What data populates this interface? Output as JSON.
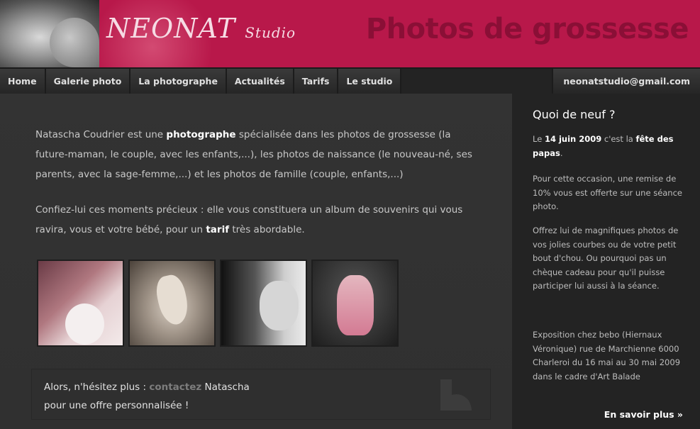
{
  "header": {
    "logo_main": "NEONAT",
    "logo_sub": "Studio",
    "tagline": "Photos de grossesse"
  },
  "nav": {
    "items": [
      "Home",
      "Galerie photo",
      "La photographe",
      "Actualités",
      "Tarifs",
      "Le studio"
    ],
    "email": "neonatstudio@gmail.com"
  },
  "intro": {
    "p1_a": "Natascha Coudrier est une ",
    "p1_b": "photographe",
    "p1_c": " spécialisée dans les photos de grossesse (la future-maman, le couple, avec les enfants,...), les photos de naissance (le nouveau-né, ses parents, avec la sage-femme,...) et les photos de famille (couple, enfants,...)",
    "p2_a": "Confiez-lui ces moments précieux : elle vous constituera un album de souvenirs qui vous ravira, vous et votre bébé, pour un ",
    "p2_b": "tarif",
    "p2_c": " très abordable."
  },
  "cta": {
    "line1_a": "Alors, n'hésitez plus : ",
    "link": "contactez",
    "line1_b": " Natascha",
    "line2": "pour une offre personnalisée !"
  },
  "sidebar": {
    "title": "Quoi de neuf ?",
    "news1_a": "Le ",
    "news1_date": "14 juin 2009",
    "news1_b": " c'est la ",
    "news1_event": "fête des papas",
    "news1_c": ".",
    "news2": "Pour cette occasion, une remise de 10% vous est offerte sur une séance photo.",
    "news3": "Offrez lui de magnifiques photos de vos jolies courbes ou de votre petit bout d'chou. Ou pourquoi pas un chèque cadeau pour qu'il puisse participer lui aussi à la séance.",
    "news4": "Exposition chez bebo (Hiernaux Véronique) rue de Marchienne 6000 Charleroi du 16 mai au 30 mai 2009 dans le cadre d'Art Balade",
    "more_label": "En savoir plus »"
  },
  "colors": {
    "brand": "#b8184a",
    "tagline": "#8a0f36",
    "background": "#3a3a3a",
    "sidebar": "#232323"
  }
}
